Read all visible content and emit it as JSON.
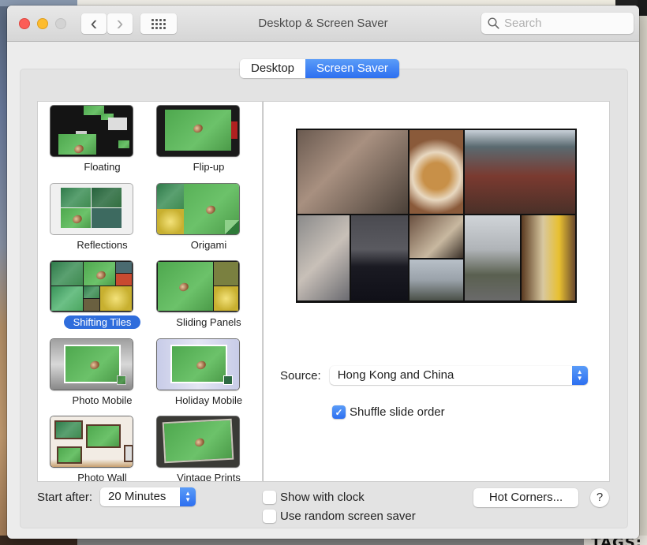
{
  "window": {
    "title": "Desktop & Screen Saver",
    "search_placeholder": "Search",
    "back_glyph": "‹",
    "forward_glyph": "›"
  },
  "tabs": [
    {
      "label": "Desktop",
      "active": false
    },
    {
      "label": "Screen Saver",
      "active": true
    }
  ],
  "screen_savers": [
    {
      "label": "Floating",
      "selected": false
    },
    {
      "label": "Flip-up",
      "selected": false
    },
    {
      "label": "Reflections",
      "selected": false
    },
    {
      "label": "Origami",
      "selected": false
    },
    {
      "label": "Shifting Tiles",
      "selected": true
    },
    {
      "label": "Sliding Panels",
      "selected": false
    },
    {
      "label": "Photo Mobile",
      "selected": false
    },
    {
      "label": "Holiday Mobile",
      "selected": false
    },
    {
      "label": "Photo Wall",
      "selected": false
    },
    {
      "label": "Vintage Prints",
      "selected": false
    }
  ],
  "options": {
    "source_label": "Source:",
    "source_value": "Hong Kong and China",
    "shuffle_label": "Shuffle slide order",
    "shuffle_checked": true
  },
  "footer": {
    "start_after_label": "Start after:",
    "start_after_value": "20 Minutes",
    "show_clock_label": "Show with clock",
    "show_clock_checked": false,
    "random_label": "Use random screen saver",
    "random_checked": false,
    "hot_corners_label": "Hot Corners...",
    "help_label": "?"
  },
  "background": {
    "tags_text": "TAGS:"
  },
  "colors": {
    "accent": "#2d6ff0",
    "selection": "#2f6ddc",
    "close": "#fc5d57",
    "minimize": "#fdbc2e"
  }
}
